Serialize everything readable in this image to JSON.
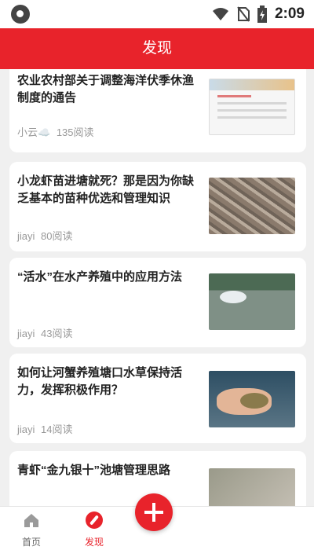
{
  "status_bar": {
    "time": "2:09"
  },
  "header": {
    "title": "发现"
  },
  "articles": [
    {
      "title": "农业农村部关于调整海洋伏季休渔制度的通告",
      "author": "小云☁️",
      "reads": "135阅读",
      "thumb": "document-thumbnail"
    },
    {
      "title": "小龙虾苗进塘就死？那是因为你缺乏基本的苗种优选和管理知识",
      "author": "jiayi",
      "reads": "80阅读",
      "thumb": "crayfish-thumbnail"
    },
    {
      "title": "“活水”在水产养殖中的应用方法",
      "author": "jiayi",
      "reads": "43阅读",
      "thumb": "pond-aerator-thumbnail"
    },
    {
      "title": "如何让河蟹养殖塘口水草保持活力，发挥积极作用？",
      "author": "jiayi",
      "reads": "14阅读",
      "thumb": "crab-thumbnail"
    },
    {
      "title": "青虾“金九银十”池塘管理思路",
      "author": "",
      "reads": "",
      "thumb": "shrimp-thumbnail"
    }
  ],
  "tabs": [
    {
      "label": "首页",
      "icon": "home-icon",
      "active": false
    },
    {
      "label": "发现",
      "icon": "compass-icon",
      "active": true
    }
  ],
  "colors": {
    "accent": "#e8232b",
    "background": "#f0f0f0"
  }
}
